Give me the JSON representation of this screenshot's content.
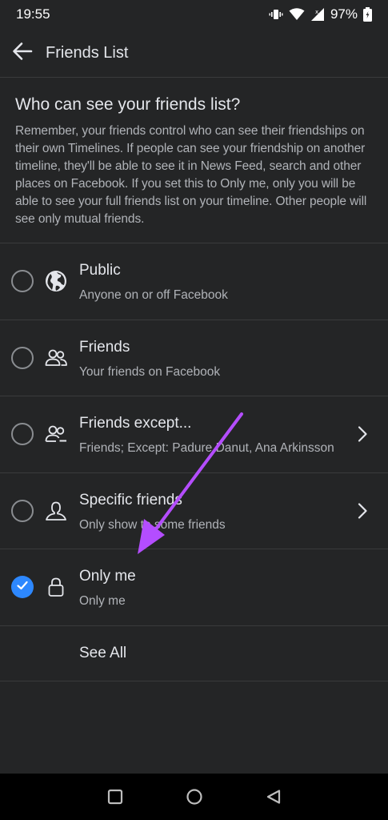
{
  "status_bar": {
    "time": "19:55",
    "battery": "97%",
    "icons": [
      "vibrate-icon",
      "wifi-icon",
      "signal-icon",
      "battery-icon"
    ]
  },
  "app_bar": {
    "title": "Friends List",
    "back_icon": "arrow-left-icon"
  },
  "intro": {
    "heading": "Who can see your friends list?",
    "body": "Remember, your friends control who can see their friendships on their own Timelines. If people can see your friendship on another timeline, they'll be able to see it in News Feed, search and other places on Facebook. If you set this to Only me, only you will be able to see your full friends list on your timeline. Other people will see only mutual friends."
  },
  "options": [
    {
      "title": "Public",
      "subtitle": "Anyone on or off Facebook",
      "icon": "globe-icon",
      "selected": false,
      "has_chevron": false
    },
    {
      "title": "Friends",
      "subtitle": "Your friends on Facebook",
      "icon": "friends-icon",
      "selected": false,
      "has_chevron": false
    },
    {
      "title": "Friends except...",
      "subtitle": "Friends; Except: Padure Danut, Ana Arkinsson",
      "icon": "friends-except-icon",
      "selected": false,
      "has_chevron": true
    },
    {
      "title": "Specific friends",
      "subtitle": "Only show to some friends",
      "icon": "specific-friend-icon",
      "selected": false,
      "has_chevron": true
    },
    {
      "title": "Only me",
      "subtitle": "Only me",
      "icon": "lock-icon",
      "selected": true,
      "has_chevron": false
    }
  ],
  "see_all": "See All",
  "nav_bar": {
    "icons": [
      "recents-square-icon",
      "home-circle-icon",
      "back-triangle-icon"
    ]
  },
  "colors": {
    "background": "#242526",
    "divider": "#3a3b3c",
    "primary_text": "#e4e6eb",
    "secondary_text": "#b0b3b8",
    "selected_radio": "#2d88ff",
    "annotation_arrow": "#b44dff"
  }
}
